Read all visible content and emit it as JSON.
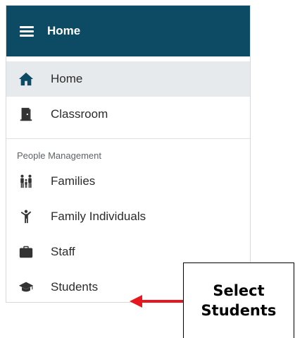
{
  "header": {
    "title": "Home"
  },
  "nav": {
    "items": [
      {
        "label": "Home",
        "icon": "home-icon"
      },
      {
        "label": "Classroom",
        "icon": "door-icon"
      }
    ],
    "section_label": "People Management",
    "people_items": [
      {
        "label": "Families",
        "icon": "family-icon"
      },
      {
        "label": "Family Individuals",
        "icon": "person-icon"
      },
      {
        "label": "Staff",
        "icon": "briefcase-icon"
      },
      {
        "label": "Students",
        "icon": "graduation-cap-icon"
      }
    ]
  },
  "callout": {
    "line1": "Select",
    "line2": "Students"
  },
  "colors": {
    "header_bg": "#0d4a63",
    "active_bg": "#e7eaed",
    "arrow": "#e8171f",
    "icon": "#333333"
  }
}
